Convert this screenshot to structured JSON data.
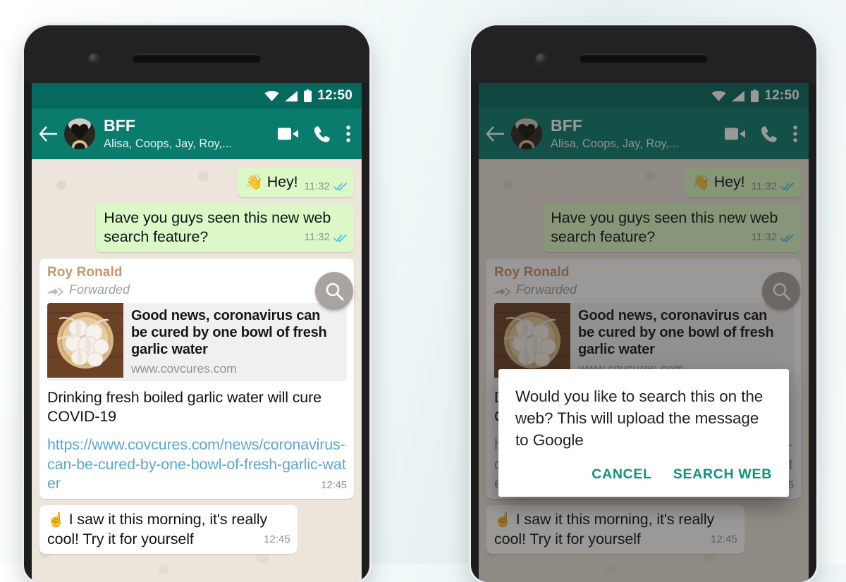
{
  "page": {
    "background_color": "#eef5f6",
    "panels": [
      "left-phone-normal-state",
      "right-phone-dialog-state"
    ]
  },
  "phone": {
    "frame_color": "#1d1d1d",
    "screen_bg": "#ece5dd"
  },
  "status_bar": {
    "time": "12:50",
    "background_color": "#05695e",
    "icons": [
      "wifi-icon",
      "signal-icon",
      "battery-icon"
    ]
  },
  "app_bar": {
    "background_color": "#0a7c6e",
    "back_icon": "back-arrow-icon",
    "avatar": "group-avatar",
    "chat_name": "BFF",
    "participants": "Alisa, Coops, Jay, Roy,...",
    "actions": [
      "video-call-icon",
      "voice-call-icon",
      "overflow-menu-icon"
    ]
  },
  "messages": [
    {
      "id": "msg-hey",
      "direction": "out",
      "emoji": "👋",
      "text": "Hey!",
      "time": "11:32",
      "status": "read",
      "layout": "inline"
    },
    {
      "id": "msg-web-search",
      "direction": "out",
      "emoji": "",
      "text": "Have you guys seen this new web search feature?",
      "time": "11:32",
      "status": "read",
      "layout": "flow"
    },
    {
      "id": "msg-saw-it",
      "direction": "in",
      "emoji": "☝️",
      "text": "I saw it this morning, it's really cool! Try it for yourself",
      "time": "12:45",
      "status": "none",
      "layout": "flow"
    }
  ],
  "forwarded_card": {
    "sender": "Roy Ronald",
    "sender_color": "#c9956a",
    "forwarded_label": "Forwarded",
    "forward_icon": "forward-arrow-icon",
    "preview": {
      "thumbnail": "garlic-basket-photo",
      "title": "Good news, coronavirus can be cured by one bowl of fresh garlic water",
      "host": "www.covcures.com"
    },
    "headline": "Drinking fresh boiled garlic water will cure COVID-19",
    "link": "https://www.covcures.com/news/coronavirus-can-be-cured-by-one-bowl-of-fresh-garlic-water",
    "link_color": "#5ba8cf",
    "time": "12:45"
  },
  "fab": {
    "icon": "search-icon",
    "background_color": "#a9a49f"
  },
  "dialog": {
    "message": "Would you like to search this on the web? This will upload the message to Google",
    "cancel_label": "CANCEL",
    "confirm_label": "SEARCH WEB",
    "action_color": "#0a9380"
  }
}
